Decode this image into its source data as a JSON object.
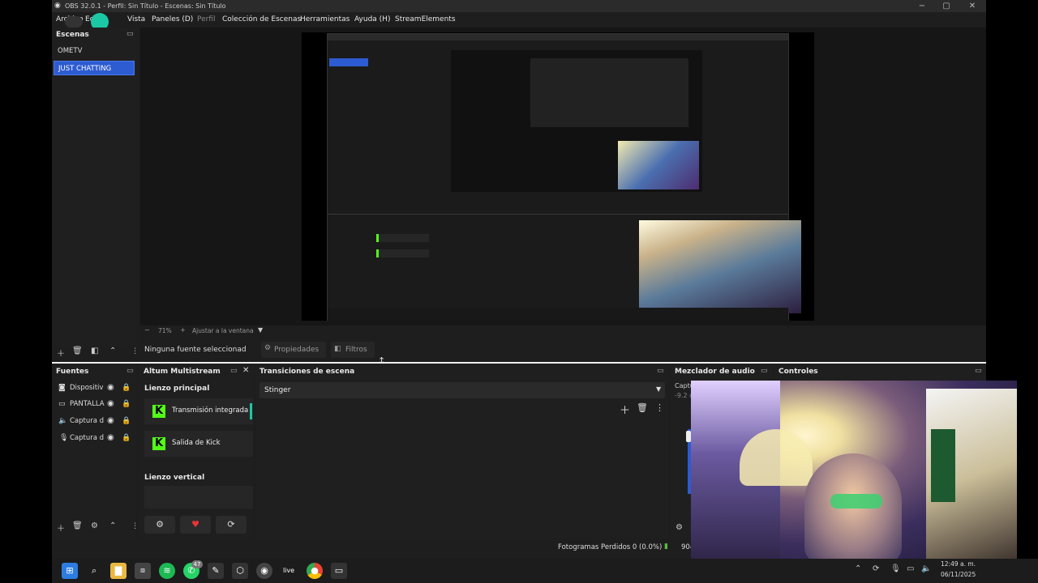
{
  "window": {
    "title": "OBS 32.0.1 - Perfil: Sin Título - Escenas: Sin Título",
    "controls": [
      "−",
      "▢",
      "✕"
    ]
  },
  "menu": [
    "Archivo",
    "Editar",
    "Vista",
    "Paneles (D)",
    "Perfil",
    "Colección de Escenas",
    "Herramientas",
    "Ayuda (H)",
    "StreamElements"
  ],
  "scenes": {
    "header": "Escenas",
    "items": [
      "OMETV",
      "JUST CHATTING"
    ],
    "selected": 1
  },
  "preview": {
    "zoom": "71%",
    "fit_label": "Ajustar a la ventana"
  },
  "source_toolbar": {
    "no_source": "Ninguna fuente seleccionad",
    "properties": "Propiedades",
    "filters": "Filtros"
  },
  "sources": {
    "header": "Fuentes",
    "items": [
      {
        "icon": "camera-icon",
        "label": "Dispositiv"
      },
      {
        "icon": "monitor-icon",
        "label": "PANTALLA"
      },
      {
        "icon": "speaker-icon",
        "label": "Captura d"
      },
      {
        "icon": "mic-icon",
        "label": "Captura d"
      }
    ]
  },
  "multistream": {
    "header": "Altum Multistream",
    "main_canvas": "Lienzo principal",
    "targets": [
      "Transmisión integrada",
      "Salida de Kick"
    ],
    "vertical_canvas": "Lienzo vertical"
  },
  "transitions": {
    "header": "Transiciones de escena",
    "selected": "Stinger"
  },
  "mixer": {
    "header": "Mezclador de audio",
    "channel": "Captu",
    "db": "-9.2 d"
  },
  "controls": {
    "header": "Controles"
  },
  "status": {
    "dropped_frames": "Fotogramas Perdidos 0 (0.0%)",
    "bitrate_partial": "904"
  },
  "taskbar": {
    "whatsapp_badge": "47",
    "live_label": "live",
    "clock_time": "12:49 a. m.",
    "clock_date": "06/11/2025"
  },
  "colors": {
    "accent": "#2d5bd1",
    "kick_green": "#53fc18",
    "bg": "#1e1e1e"
  }
}
